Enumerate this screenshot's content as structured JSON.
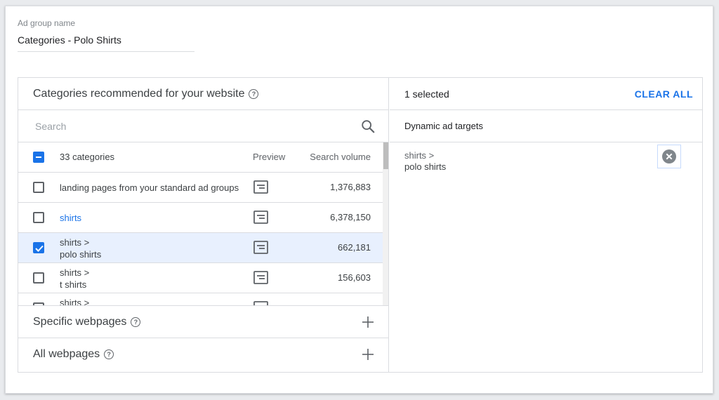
{
  "ad_group": {
    "label": "Ad group name",
    "value": "Categories - Polo Shirts"
  },
  "categories_panel": {
    "title": "Categories recommended for your website",
    "search_placeholder": "Search",
    "header": {
      "count": "33 categories",
      "preview": "Preview",
      "volume": "Search volume"
    },
    "rows": [
      {
        "line1": "landing pages from your standard ad groups",
        "line2": "",
        "volume": "1,376,883",
        "checked": false
      },
      {
        "line1": "shirts",
        "line2": "",
        "volume": "6,378,150",
        "checked": false
      },
      {
        "line1": "shirts >",
        "line2": "polo shirts",
        "volume": "662,181",
        "checked": true
      },
      {
        "line1": "shirts >",
        "line2": "t shirts",
        "volume": "156,603",
        "checked": false
      },
      {
        "line1": "shirts >",
        "line2": "",
        "volume": "",
        "checked": false
      }
    ]
  },
  "sections": {
    "specific": "Specific webpages",
    "all": "All webpages"
  },
  "selection_panel": {
    "count": "1 selected",
    "clear_all": "CLEAR ALL",
    "subheader": "Dynamic ad targets",
    "targets": [
      {
        "line1": "shirts >",
        "line2": "polo shirts"
      }
    ]
  },
  "colors": {
    "accent": "#1a73e8",
    "selected_row": "#e8f0fe"
  },
  "icons": {
    "help": "help-circle-icon",
    "search": "search-icon",
    "preview": "ad-preview-icon",
    "add": "plus-icon",
    "remove": "remove-circle-icon"
  }
}
